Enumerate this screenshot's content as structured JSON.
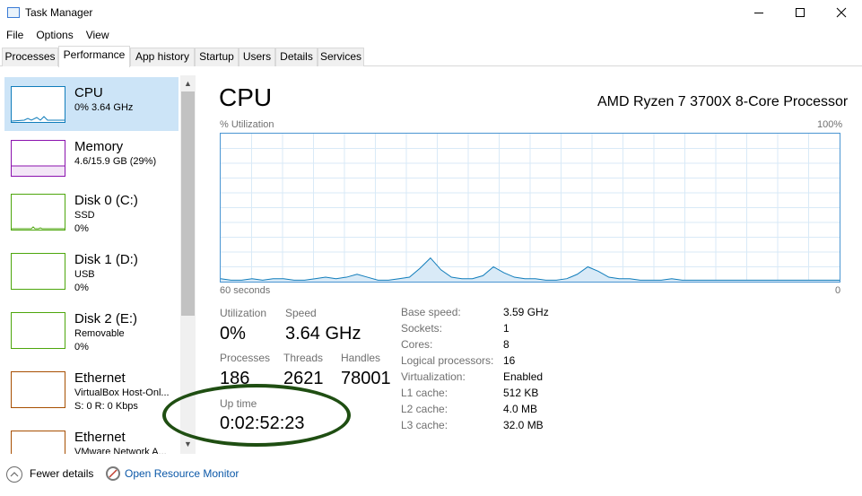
{
  "window": {
    "title": "Task Manager",
    "minimize_icon": "minimize-icon",
    "maximize_icon": "maximize-icon",
    "close_icon": "close-icon"
  },
  "menu": {
    "items": [
      "File",
      "Options",
      "View"
    ]
  },
  "tabs": {
    "items": [
      "Processes",
      "Performance",
      "App history",
      "Startup",
      "Users",
      "Details",
      "Services"
    ],
    "active": "Performance"
  },
  "sidebar": {
    "items": [
      {
        "name": "CPU",
        "line1": "0% 3.64 GHz",
        "line2": "",
        "color": "#117dbb"
      },
      {
        "name": "Memory",
        "line1": "4.6/15.9 GB (29%)",
        "line2": "",
        "color": "#8b12ae"
      },
      {
        "name": "Disk 0 (C:)",
        "line1": "SSD",
        "line2": "0%",
        "color": "#4da60c"
      },
      {
        "name": "Disk 1 (D:)",
        "line1": "USB",
        "line2": "0%",
        "color": "#4da60c"
      },
      {
        "name": "Disk 2 (E:)",
        "line1": "Removable",
        "line2": "0%",
        "color": "#4da60c"
      },
      {
        "name": "Ethernet",
        "line1": "VirtualBox Host-Onl...",
        "line2": "S: 0 R: 0 Kbps",
        "color": "#a74f01"
      },
      {
        "name": "Ethernet",
        "line1": "VMware Network A...",
        "line2": "",
        "color": "#a74f01"
      }
    ]
  },
  "panel": {
    "title": "CPU",
    "processor": "AMD Ryzen 7 3700X 8-Core Processor",
    "graph_label": "% Utilization",
    "graph_max": "100%",
    "graph_time": "60 seconds",
    "graph_min": "0"
  },
  "stats": {
    "utilization_label": "Utilization",
    "utilization": "0%",
    "speed_label": "Speed",
    "speed": "3.64 GHz",
    "processes_label": "Processes",
    "processes": "186",
    "threads_label": "Threads",
    "threads": "2621",
    "handles_label": "Handles",
    "handles": "78001",
    "uptime_label": "Up time",
    "uptime": "0:02:52:23"
  },
  "specs": [
    {
      "label": "Base speed:",
      "value": "3.59 GHz"
    },
    {
      "label": "Sockets:",
      "value": "1"
    },
    {
      "label": "Cores:",
      "value": "8"
    },
    {
      "label": "Logical processors:",
      "value": "16"
    },
    {
      "label": "Virtualization:",
      "value": "Enabled"
    },
    {
      "label": "L1 cache:",
      "value": "512 KB"
    },
    {
      "label": "L2 cache:",
      "value": "4.0 MB"
    },
    {
      "label": "L3 cache:",
      "value": "32.0 MB"
    }
  ],
  "cpu_history": [
    2,
    1,
    1,
    2,
    1,
    2,
    2,
    1,
    1,
    2,
    3,
    2,
    3,
    5,
    3,
    1,
    1,
    2,
    3,
    9,
    16,
    8,
    3,
    2,
    2,
    4,
    10,
    6,
    3,
    2,
    2,
    1,
    1,
    2,
    5,
    10,
    7,
    3,
    2,
    2,
    1,
    1,
    1,
    2,
    1,
    1,
    1,
    1,
    1,
    1,
    1,
    1,
    1,
    1,
    1,
    1,
    1,
    1,
    1,
    1
  ],
  "colors": {
    "cpu": "#117dbb",
    "graph_fill": "#d9eaf7",
    "grid": "#d9eaf7",
    "annotation": "#1f4e12",
    "link": "#0b58a8"
  },
  "footer": {
    "fewer_details": "Fewer details",
    "fewer_icon": "chevron-up-icon",
    "resource_monitor": "Open Resource Monitor",
    "monitor_icon": "resource-monitor-icon"
  }
}
